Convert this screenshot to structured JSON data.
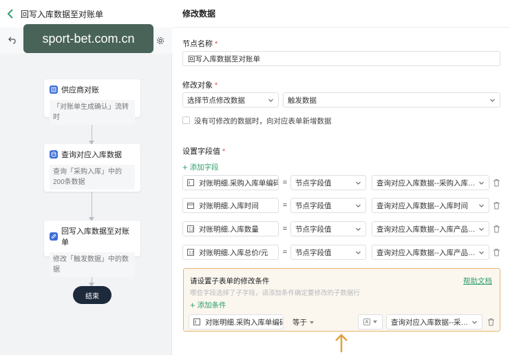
{
  "flow": {
    "title": "回写入库数据至对账单",
    "nodes": [
      {
        "title": "供应商对账",
        "desc": "「对账单生成确认」流转时"
      },
      {
        "title": "查询对应入库数据",
        "desc": "查询「采购入库」中的200条数据"
      },
      {
        "title": "回写入库数据至对账单",
        "desc": "修改「触发数据」中的数据"
      }
    ],
    "end_label": "结束"
  },
  "watermark": "sport-bet.com.cn",
  "panel": {
    "title": "修改数据",
    "node_name_label": "节点名称",
    "node_name_value": "回写入库数据至对账单",
    "target_label": "修改对象",
    "target_select": "选择节点修改数据",
    "target_data": "触发数据",
    "checkbox_label": "没有可修改的数据时，向对应表单新增数据",
    "fields_label": "设置字段值",
    "add_field": "添加字段",
    "eq_symbol": "=",
    "field_rows": [
      {
        "field": "对账明细.采购入库单编码",
        "source": "节点字段值",
        "value": "查询对应入库数据--采购入库单..."
      },
      {
        "field": "对账明细.入库时间",
        "source": "节点字段值",
        "value": "查询对应入库数据--入库时间"
      },
      {
        "field": "对账明细.入库数量",
        "source": "节点字段值",
        "value": "查询对应入库数据--入库产品总数"
      },
      {
        "field": "对账明细.入库总价/元",
        "source": "节点字段值",
        "value": "查询对应入库数据--入库产品采..."
      }
    ],
    "condition": {
      "title": "请设置子表单的修改条件",
      "help": "帮助文档",
      "hint": "哪些字段选择了子字段，请添加条件确定要修改的子数据行",
      "add_label": "添加条件",
      "field": "对账明细.采购入库单编码",
      "operator": "等于",
      "type_badge": "A",
      "value": "查询对应入库数据--采购..."
    }
  },
  "colors": {
    "accent": "#2f9e6c",
    "highlight": "#e9b46a",
    "node_icon": "#3d6fd8",
    "end_node": "#1d2a3c"
  }
}
